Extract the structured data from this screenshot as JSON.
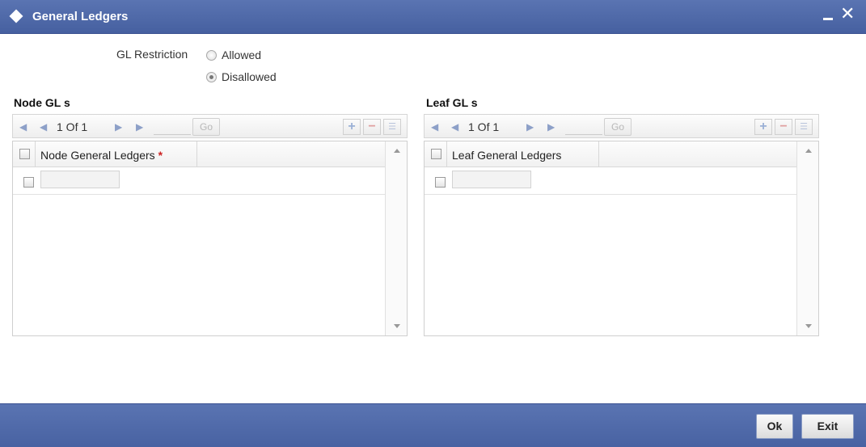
{
  "window": {
    "title": "General Ledgers",
    "minimize_icon": "minimize-icon",
    "close_icon": "close-icon",
    "close_glyph": "✕"
  },
  "gl_restriction": {
    "label": "GL Restriction",
    "options": [
      {
        "label": "Allowed",
        "selected": false
      },
      {
        "label": "Disallowed",
        "selected": true
      }
    ]
  },
  "node_gls": {
    "title": "Node GL s",
    "pager": {
      "first": "◀",
      "prev": "◀",
      "page_text": "1 Of 1",
      "next": "▶",
      "last": "▶",
      "go_label": "Go"
    },
    "buttons": {
      "add": "+",
      "delete": "−",
      "menu": "☰"
    },
    "column": {
      "label": "Node General Ledgers",
      "required_marker": "*"
    },
    "rows": [
      {
        "value": ""
      }
    ]
  },
  "leaf_gls": {
    "title": "Leaf GL s",
    "pager": {
      "first": "◀",
      "prev": "◀",
      "page_text": "1 Of 1",
      "next": "▶",
      "last": "▶",
      "go_label": "Go"
    },
    "buttons": {
      "add": "+",
      "delete": "−",
      "menu": "☰"
    },
    "column": {
      "label": "Leaf General Ledgers"
    },
    "rows": [
      {
        "value": ""
      }
    ]
  },
  "footer": {
    "ok_label": "Ok",
    "exit_label": "Exit"
  },
  "colors": {
    "titlebar": "#4e68a8",
    "footer": "#4e68a8",
    "required": "#cc2222"
  }
}
